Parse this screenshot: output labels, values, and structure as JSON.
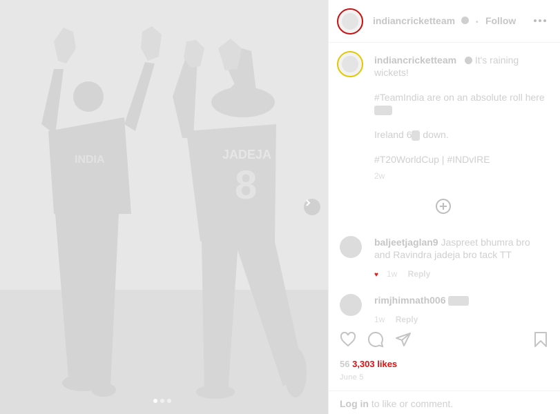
{
  "post": {
    "account": "indiancricketteam",
    "follow_label": "Follow",
    "separator": "•"
  },
  "caption": {
    "username": "indiancricketteam",
    "line1": "It's raining wickets!",
    "line2": "#TeamIndia are on an absolute roll here",
    "line3_prefix": "Ireland 6",
    "line3_suffix": " down.",
    "line4": "#T20WorldCup | #INDvIRE",
    "time": "2w"
  },
  "comments": [
    {
      "username": "baljeetjaglan9",
      "text": "Jaspreet bhumra bro and Ravindra jadeja bro tack TT",
      "time": "1w",
      "reply_label": "Reply"
    },
    {
      "username": "rimjhimnath006",
      "text": "",
      "time": "1w",
      "reply_label": "Reply"
    }
  ],
  "likes": {
    "prefix": "56",
    "count_text": "3,303 likes"
  },
  "date": "June 5",
  "login": {
    "link_label": "Log in",
    "rest": " to like or comment."
  },
  "jersey": {
    "name": "JADEJA",
    "number": "8",
    "logo_text": "INDIA"
  },
  "icons": {
    "like": "heart-icon",
    "comment": "comment-icon",
    "share": "share-icon",
    "save": "bookmark-icon",
    "more": "more-icon",
    "next": "chevron-right-icon",
    "load_more": "plus-circle-icon"
  },
  "colors": {
    "accent_red": "#d82020",
    "avatar_ring": "#c81010",
    "avatar_ring_alt": "#e2c800"
  }
}
